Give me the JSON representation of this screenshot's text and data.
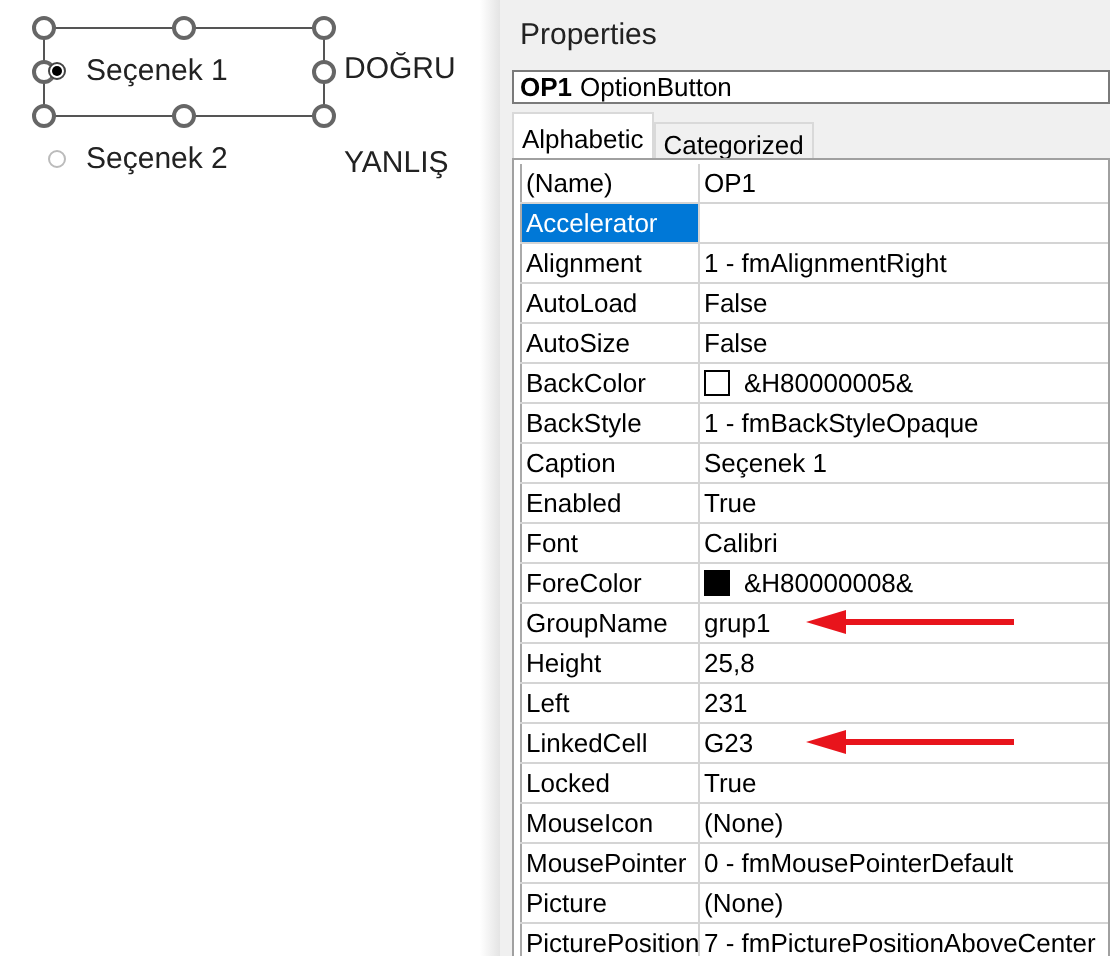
{
  "sheet": {
    "options": [
      {
        "label": "Seçenek 1",
        "selected": true,
        "design_selected": true
      },
      {
        "label": "Seçenek 2",
        "selected": false,
        "design_selected": false
      }
    ],
    "labels": [
      "DOĞRU",
      "YANLIŞ"
    ]
  },
  "properties": {
    "title": "Properties",
    "object": {
      "name": "OP1",
      "type": "OptionButton"
    },
    "tabs": [
      {
        "label": "Alphabetic",
        "selected": true
      },
      {
        "label": "Categorized",
        "selected": false
      }
    ],
    "rows": [
      {
        "name": "(Name)",
        "value": "OP1",
        "kind": "text",
        "selected": false
      },
      {
        "name": "Accelerator",
        "kind": "text",
        "selected": true
      },
      {
        "name": "Alignment",
        "value": "1 - fmAlignmentRight",
        "kind": "text",
        "selected": false
      },
      {
        "name": "AutoLoad",
        "value": "False",
        "kind": "text",
        "selected": false
      },
      {
        "name": "AutoSize",
        "value": "False",
        "kind": "text",
        "selected": false
      },
      {
        "name": "BackColor",
        "value": "&H80000005&",
        "kind": "color",
        "color": "#ffffff",
        "selected": false
      },
      {
        "name": "BackStyle",
        "value": "1 - fmBackStyleOpaque",
        "kind": "text",
        "selected": false
      },
      {
        "name": "Caption",
        "value": "Seçenek 1",
        "kind": "text",
        "selected": false
      },
      {
        "name": "Enabled",
        "value": "True",
        "kind": "text",
        "selected": false
      },
      {
        "name": "Font",
        "value": "Calibri",
        "kind": "text",
        "selected": false
      },
      {
        "name": "ForeColor",
        "value": "&H80000008&",
        "kind": "color",
        "color": "#000000",
        "selected": false
      },
      {
        "name": "GroupName",
        "value": "grup1",
        "kind": "text",
        "selected": false,
        "arrow": true
      },
      {
        "name": "Height",
        "value": "25,8",
        "kind": "text",
        "selected": false
      },
      {
        "name": "Left",
        "value": "231",
        "kind": "text",
        "selected": false
      },
      {
        "name": "LinkedCell",
        "value": "G23",
        "kind": "text",
        "selected": false,
        "arrow": true
      },
      {
        "name": "Locked",
        "value": "True",
        "kind": "text",
        "selected": false
      },
      {
        "name": "MouseIcon",
        "value": "(None)",
        "kind": "text",
        "selected": false
      },
      {
        "name": "MousePointer",
        "value": "0 - fmMousePointerDefault",
        "kind": "text",
        "selected": false
      },
      {
        "name": "Picture",
        "value": "(None)",
        "kind": "text",
        "selected": false
      },
      {
        "name": "PicturePosition",
        "value": "7 - fmPicturePositionAboveCenter",
        "kind": "text",
        "selected": false
      }
    ]
  }
}
